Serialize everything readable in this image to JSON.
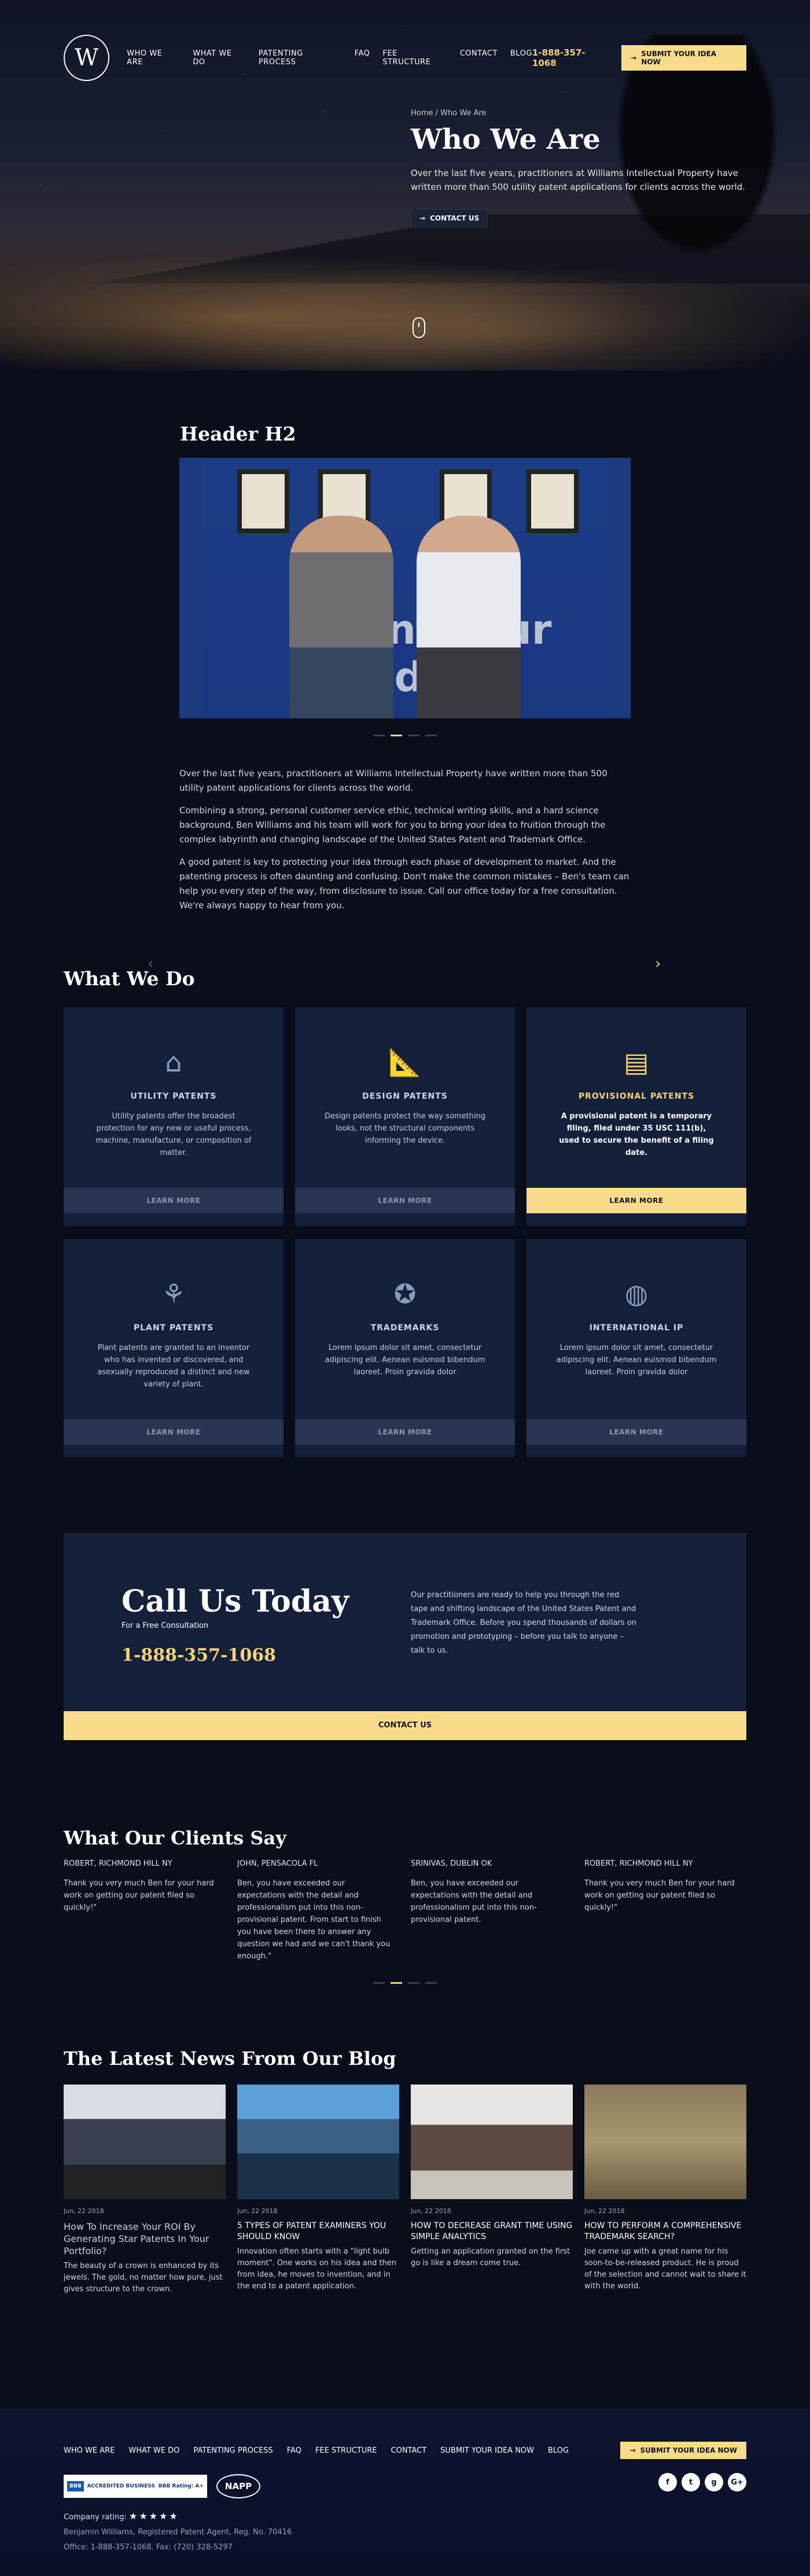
{
  "nav": {
    "logo_letter": "W",
    "items": [
      "WHO WE ARE",
      "WHAT WE DO",
      "PATENTING PROCESS",
      "FAQ",
      "FEE STRUCTURE",
      "CONTACT",
      "BLOG"
    ],
    "phone": "1-888-357-1068",
    "submit": "SUBMIT YOUR IDEA NOW"
  },
  "hero": {
    "breadcrumb_home": "Home",
    "breadcrumb_sep": "/",
    "breadcrumb_current": "Who We Are",
    "title": "Who We Are",
    "text": "Over the last five years, practitioners at Williams Intellectual Property have written more than 500 utility patent applications for clients across the world.",
    "cta": "CONTACT US"
  },
  "about": {
    "heading": "Header H2",
    "slide_text": "Invent Your World",
    "paragraphs": [
      "Over the last five years, practitioners at Williams Intellectual Property have written more than 500 utility patent applications for clients across the world.",
      "Combining a strong, personal customer service ethic, technical writing skills, and a hard science background, Ben Williams and his team will work for you to bring your idea to fruition through the complex labyrinth and changing landscape of the United States Patent and Trademark Office.",
      "A good patent is key to protecting your idea through each phase of development to market.  And the patenting process is often daunting and confusing.  Don't make the common mistakes – Ben's team can help you every step of the way, from disclosure to issue.  Call our office today for a free consultation.  We're always happy to hear from you."
    ]
  },
  "what": {
    "heading": "What We Do",
    "learn_more": "LEARN MORE",
    "cards": [
      {
        "title": "UTILITY PATENTS",
        "text": "Utility patents offer the broadest protection for any new or useful process, machine, manufacture, or composition of matter.",
        "icon": "house-icon"
      },
      {
        "title": "DESIGN PATENTS",
        "text": "Design patents protect the way something looks, not the structural components informing the device.",
        "icon": "ruler-icon"
      },
      {
        "title": "PROVISIONAL PATENTS",
        "text": "A provisional patent is a temporary filing, filed under 35 USC 111(b), used to secure the benefit of a filing date.",
        "icon": "document-icon"
      },
      {
        "title": "PLANT PATENTS",
        "text": "Plant patents are granted to an inventor who has invented or discovered, and asexually reproduced a distinct and new variety of plant.",
        "icon": "plant-icon"
      },
      {
        "title": "TRADEMARKS",
        "text": "Lorem ipsum dolor sit amet, consectetur adipiscing elit. Aenean euismod bibendum laoreet. Proin gravida dolor",
        "icon": "award-icon"
      },
      {
        "title": "INTERNATIONAL IP",
        "text": "Lorem ipsum dolor sit amet, consectetur adipiscing elit. Aenean euismod bibendum laoreet. Proin gravida dolor",
        "icon": "globe-icon"
      }
    ]
  },
  "call": {
    "title": "Call Us Today",
    "sub": "For a Free Consultation",
    "number": "1-888-357-1068",
    "text": "Our practitioners are ready to help you through the red tape and shifting landscape of the United States Patent and Trademark Office. Before you spend thousands of dollars on promotion and prototyping – before you talk to anyone – talk to us.",
    "cta": "CONTACT US"
  },
  "testimonials": {
    "heading": "What Our Clients Say",
    "items": [
      {
        "name": "ROBERT, RICHMOND HILL NY",
        "text": "Thank you very much Ben for your hard work on getting our patent filed so quickly!\""
      },
      {
        "name": "JOHN, PENSACOLA FL",
        "text": "Ben, you have exceeded our expectations with the detail and professionalism put into this non-provisional patent. From start to finish you have been there to answer any question we had and we can't thank you enough.\""
      },
      {
        "name": "SRINIVAS, DUBLIN OK",
        "text": "Ben, you have exceeded our expectations with the detail and professionalism put into this non-provisional patent."
      },
      {
        "name": "ROBERT, RICHMOND HILL NY",
        "text": "Thank you very much Ben for your hard work on getting our patent filed so quickly!\""
      }
    ]
  },
  "blog": {
    "heading": "The Latest News From Our Blog",
    "posts": [
      {
        "date": "Jun, 22 2018",
        "title": "How To Increase Your ROI By Generating Star Patents In Your Portfolio?",
        "text": "The beauty of a crown is enhanced by its jewels. The gold, no matter how pure, just gives structure to the crown."
      },
      {
        "date": "Jun, 22 2018",
        "title": "5 TYPES OF PATENT EXAMINERS YOU SHOULD KNOW",
        "text": "Innovation often starts with a \"light bulb moment\". One works on his idea and then from idea, he moves to invention, and in the end to a patent application."
      },
      {
        "date": "Jun, 22 2018",
        "title": "HOW TO DECREASE GRANT TIME USING SIMPLE ANALYTICS",
        "text": "Getting an application granted on the first go is like a dream come true."
      },
      {
        "date": "Jun, 22 2018",
        "title": "HOW TO PERFORM A COMPREHENSIVE TRADEMARK SEARCH?",
        "text": "Joe came up with a great name for his soon-to-be-released product. He is proud of the selection and cannot wait to share it with the world."
      }
    ]
  },
  "footer": {
    "items": [
      "WHO WE ARE",
      "WHAT WE DO",
      "PATENTING PROCESS",
      "FAQ",
      "FEE STRUCTURE",
      "CONTACT",
      "SUBMIT YOUR IDEA NOW",
      "BLOG"
    ],
    "submit": "SUBMIT YOUR IDEA NOW",
    "bbb_label": "ACCREDITED BUSINESS",
    "bbb_rating": "BBB Rating: A+",
    "napp": "NAPP",
    "rating_label": "Company rating:",
    "rating_stars": 5,
    "stars_text": "★★★★★",
    "agent": "Benjamin Williams, Registered Patent Agent, Reg. No. 70416",
    "contact": "Office: 1-888-357-1068. Fax: (720) 328-5297",
    "social": [
      "f",
      "t",
      "g",
      "G+"
    ]
  },
  "colors": {
    "accent": "#f8dc8c",
    "card": "#14203a",
    "bg": "#0a0d1a"
  }
}
